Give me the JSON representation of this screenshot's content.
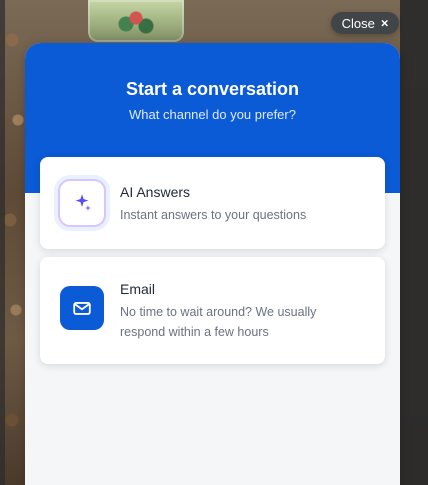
{
  "overlay": {
    "close_label": "Close",
    "close_icon": "×"
  },
  "modal": {
    "title": "Start a conversation",
    "subtitle": "What channel do you prefer?"
  },
  "options": [
    {
      "title": "AI Answers",
      "description": "Instant answers to your questions",
      "icon": "sparkles-icon"
    },
    {
      "title": "Email",
      "description": "No time to wait around? We usually respond within a few hours",
      "icon": "envelope-icon"
    }
  ],
  "colors": {
    "primary": "#0b5ad6",
    "modal_background": "#f4f6f8",
    "card_background": "#ffffff",
    "title_text": "#ffffff",
    "subtitle_text": "#dbe8ff",
    "option_title_text": "#1f2937",
    "option_description_text": "#6b7280",
    "close_background": "#373f47"
  }
}
